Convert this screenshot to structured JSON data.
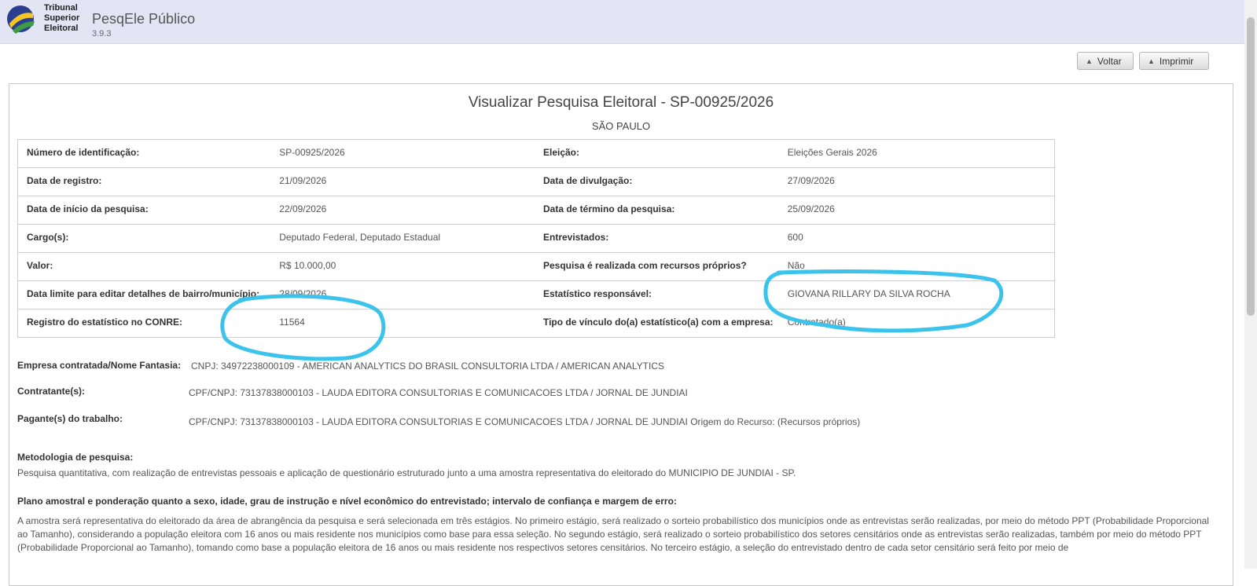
{
  "header": {
    "logo_text_1": "Tribunal",
    "logo_text_2": "Superior",
    "logo_text_3": "Eleitoral",
    "app_name": "PesqEle Público",
    "version": "3.9.3"
  },
  "toolbar": {
    "back_label": "Voltar",
    "print_label": "Imprimir"
  },
  "page": {
    "title": "Visualizar Pesquisa Eleitoral - SP-00925/2026",
    "subtitle": "SÃO PAULO"
  },
  "details": [
    {
      "l1": "Número de identificação:",
      "v1": "SP-00925/2026",
      "l2": "Eleição:",
      "v2": "Eleições Gerais 2026"
    },
    {
      "l1": "Data de registro:",
      "v1": "21/09/2026",
      "l2": "Data de divulgação:",
      "v2": "27/09/2026"
    },
    {
      "l1": "Data de início da pesquisa:",
      "v1": "22/09/2026",
      "l2": "Data de término da pesquisa:",
      "v2": "25/09/2026"
    },
    {
      "l1": "Cargo(s):",
      "v1": "Deputado Federal, Deputado Estadual",
      "l2": "Entrevistados:",
      "v2": "600"
    },
    {
      "l1": "Valor:",
      "v1": "R$ 10.000,00",
      "l2": "Pesquisa é realizada com recursos próprios?",
      "v2": "Não"
    },
    {
      "l1": "Data limite para editar detalhes de bairro/município:",
      "v1": "28/09/2026",
      "l2": "Estatístico responsável:",
      "v2": "GIOVANA RILLARY DA SILVA ROCHA"
    },
    {
      "l1": "Registro do estatístico no CONRE:",
      "v1": "11564",
      "l2": "Tipo de vínculo do(a) estatístico(a) com a empresa:",
      "v2": "Contratado(a)"
    }
  ],
  "company": {
    "label": "Empresa contratada/Nome Fantasia:",
    "value": "CNPJ: 34972238000109 - AMERICAN ANALYTICS DO BRASIL CONSULTORIA LTDA / AMERICAN ANALYTICS"
  },
  "contractor": {
    "label": "Contratante(s):",
    "value": "CPF/CNPJ: 73137838000103 - LAUDA EDITORA CONSULTORIAS E COMUNICACOES LTDA / JORNAL DE JUNDIAI"
  },
  "payer": {
    "label": "Pagante(s) do trabalho:",
    "value": "CPF/CNPJ: 73137838000103 - LAUDA EDITORA CONSULTORIAS E COMUNICACOES LTDA / JORNAL DE JUNDIAI Origem do Recurso: (Recursos próprios)"
  },
  "methodology": {
    "label": "Metodologia de pesquisa:",
    "text": "Pesquisa quantitativa, com realização de entrevistas pessoais e aplicação de questionário estruturado junto a uma amostra representativa do eleitorado do MUNICIPIO DE JUNDIAI - SP."
  },
  "sampling": {
    "label": "Plano amostral e ponderação quanto a sexo, idade, grau de instrução e nível econômico do entrevistado; intervalo de confiança e margem de erro:",
    "text": "A amostra será representativa do eleitorado da área de abrangência da pesquisa e será selecionada em três estágios. No primeiro estágio, será realizado o sorteio probabilístico dos municípios onde as entrevistas serão realizadas, por meio do método PPT (Probabilidade Proporcional ao Tamanho), considerando a população eleitora com 16 anos ou mais residente nos municípios como base para essa seleção. No segundo estágio, será realizado o sorteio probabilístico dos setores censitários onde as entrevistas serão realizadas, também por meio do método PPT (Probabilidade Proporcional ao Tamanho), tomando como base a população eleitora de 16 anos ou mais residente nos respectivos setores censitários. No terceiro estágio, a seleção do entrevistado dentro de cada setor censitário será feito por meio de"
  },
  "colors": {
    "header_bg": "#e3e5f5",
    "annotation": "#3cc3ec"
  }
}
